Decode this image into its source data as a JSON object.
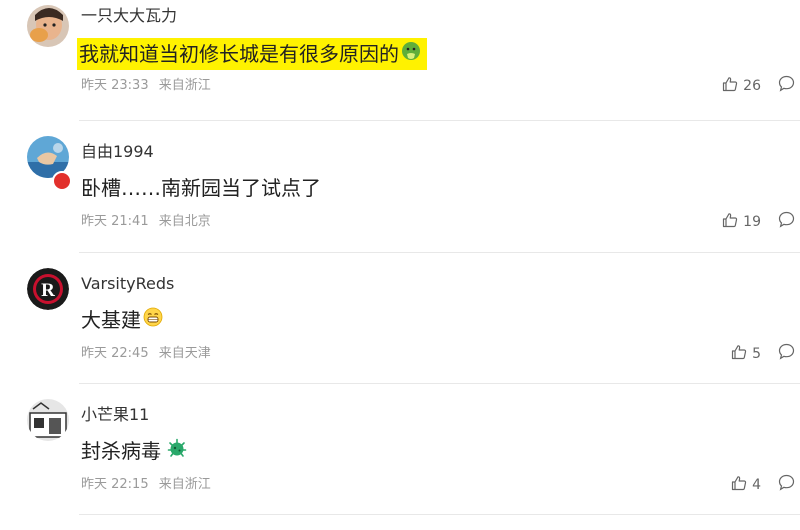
{
  "comments": [
    {
      "user": "一只大大瓦力",
      "text": "我就知道当初修长城是有很多原因的",
      "time": "昨天 23:33",
      "location": "来自浙江",
      "likes": "26",
      "emoji": "vomit-face-icon",
      "highlight_color": "#fff200"
    },
    {
      "user": "自由1994",
      "text": "卧槽……南新园当了试点了",
      "time": "昨天 21:41",
      "location": "来自北京",
      "likes": "19"
    },
    {
      "user": "VarsityReds",
      "text": "大基建",
      "time": "昨天 22:45",
      "location": "来自天津",
      "likes": "5",
      "emoji": "grin-face-icon"
    },
    {
      "user": "小芒果11",
      "text": "封杀病毒",
      "time": "昨天 22:15",
      "location": "来自浙江",
      "likes": "4",
      "emoji": "virus-icon"
    }
  ]
}
